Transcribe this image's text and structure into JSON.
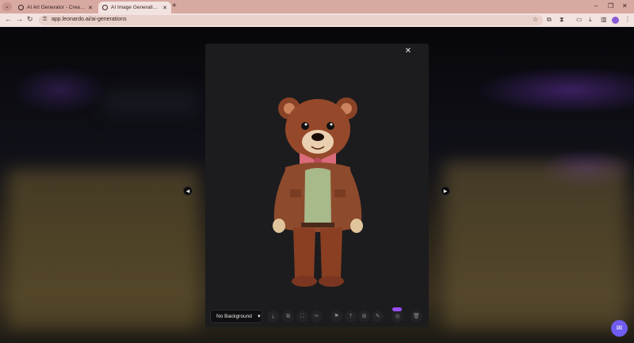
{
  "browser": {
    "tabs": [
      {
        "title": "AI Art Generator - Create Art",
        "close": "✕",
        "active": false
      },
      {
        "title": "AI Image Generation | Leonardo",
        "close": "✕",
        "active": true
      }
    ],
    "menu_glyph": "⌄",
    "new_tab": "+",
    "url": "app.leonardo.ai/ai-generations",
    "window_controls": {
      "minimize": "–",
      "restore": "❐",
      "close": "✕"
    },
    "icons": {
      "back": "←",
      "forward": "→",
      "reload": "↻",
      "lock": "⚿",
      "star": "☆",
      "screenshot": "⧉",
      "extensions": "⧗",
      "cast": "▭",
      "download": "⤓",
      "sidepanel": "▥",
      "more": "⋮"
    }
  },
  "modal": {
    "close": "✕",
    "prev": "◀",
    "next": "▶",
    "background_select": {
      "value": "No Background",
      "caret": "▼"
    },
    "actions": [
      {
        "name": "download-button",
        "glyph": "⤓"
      },
      {
        "name": "copy-button",
        "glyph": "⧉"
      },
      {
        "name": "expand-button",
        "glyph": "⛶"
      },
      {
        "name": "remove-bg-button",
        "glyph": "✂"
      },
      {
        "name": "bookmark-button",
        "glyph": "⚑"
      },
      {
        "name": "upscale-button",
        "glyph": "⇡"
      },
      {
        "name": "variation-button",
        "glyph": "⊞"
      },
      {
        "name": "edit-button",
        "glyph": "✎"
      },
      {
        "name": "motion-button",
        "glyph": "◎"
      },
      {
        "name": "delete-button",
        "glyph": "🗑"
      }
    ]
  },
  "chat": {
    "glyph": "✉"
  },
  "colors": {
    "accent": "#6f5cf0",
    "badge": "#9a4df0",
    "tabbar": "#d7a9a1",
    "modal": "#1c1c1e"
  }
}
